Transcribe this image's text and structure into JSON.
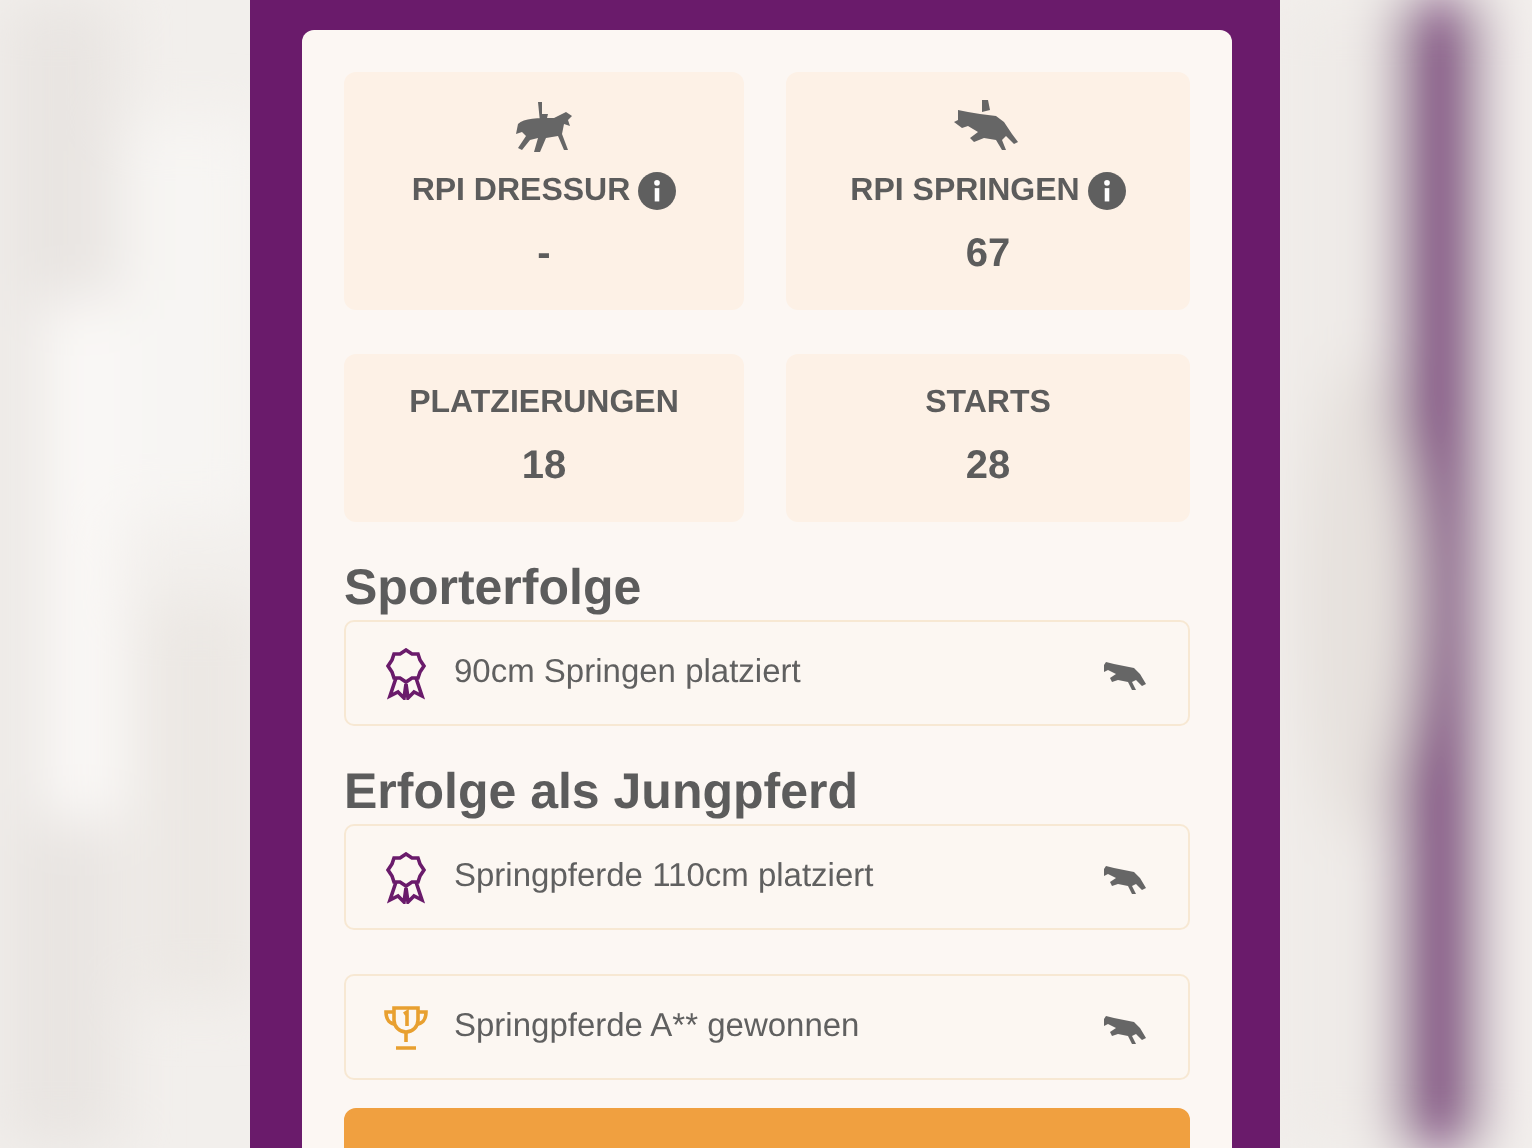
{
  "stats": [
    {
      "kind": "dressage",
      "label": "RPI DRESSUR",
      "info": true,
      "value": "-"
    },
    {
      "kind": "jumping",
      "label": "RPI SPRINGEN",
      "info": true,
      "value": "67"
    },
    {
      "label": "PLATZIERUNGEN",
      "value": "18"
    },
    {
      "label": "STARTS",
      "value": "28"
    }
  ],
  "sections": [
    {
      "title": "Sporterfolge",
      "items": [
        {
          "kind": "placed",
          "text": "90cm Springen platziert",
          "discipline": {
            "kind": "jumping"
          }
        }
      ]
    },
    {
      "title": "Erfolge als Jungpferd",
      "items": [
        {
          "kind": "placed",
          "text": "Springpferde 110cm platziert",
          "discipline": {
            "kind": "jumping"
          }
        },
        {
          "kind": "won",
          "text": "Springpferde A** gewonnen",
          "discipline": {
            "kind": "jumping"
          }
        }
      ]
    }
  ],
  "bottom_button": {
    "visible": true
  }
}
